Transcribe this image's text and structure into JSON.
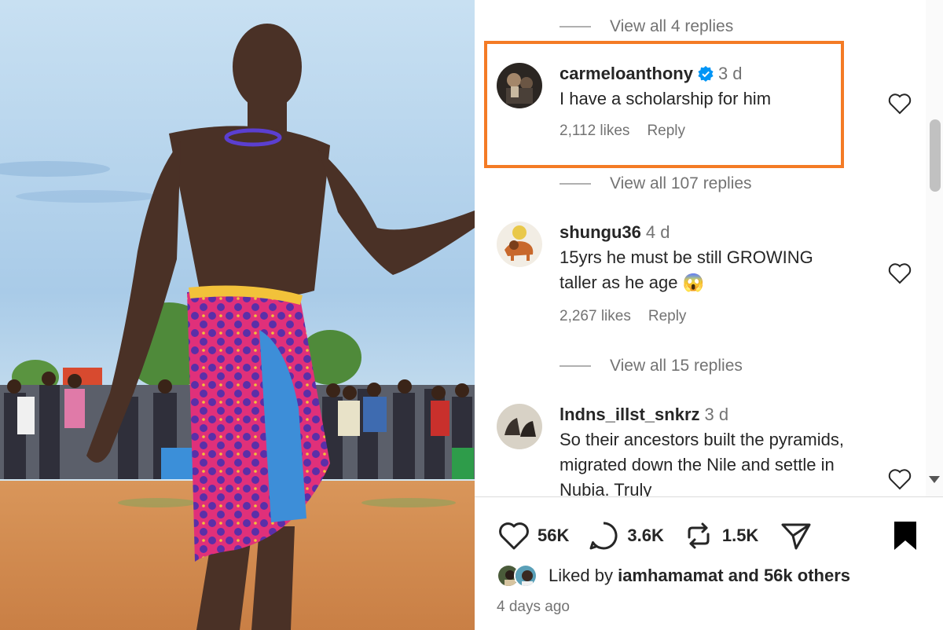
{
  "comments": [
    {
      "username": "carmeloanthony",
      "verified": true,
      "time": "3 d",
      "text": "I have a scholarship for him",
      "likes": "2,112 likes",
      "reply": "Reply",
      "view_replies": "View all 107 replies"
    },
    {
      "username": "shungu36",
      "verified": false,
      "time": "4 d",
      "text": "15yrs he must be still GROWING taller as he age 😱",
      "likes": "2,267 likes",
      "reply": "Reply",
      "view_replies": "View all 15 replies"
    },
    {
      "username": "lndns_illst_snkrz",
      "verified": false,
      "time": "3 d",
      "text": "So their ancestors built the pyramids, migrated down the Nile and settle in Nubia. Truly"
    }
  ],
  "top_view_replies": "View all 4 replies",
  "actions": {
    "likes": "56K",
    "comments": "3.6K",
    "reposts": "1.5K"
  },
  "liked_by": {
    "prefix": "Liked by",
    "user": "iamhamamat",
    "suffix": "and 56k others"
  },
  "posted": "4 days ago",
  "colors": {
    "highlight": "#f47b25",
    "verified": "#0095f6",
    "muted": "#737373"
  },
  "icons": [
    "heart-icon",
    "comment-icon",
    "repost-icon",
    "share-icon",
    "bookmark-icon",
    "verified-badge-icon"
  ]
}
